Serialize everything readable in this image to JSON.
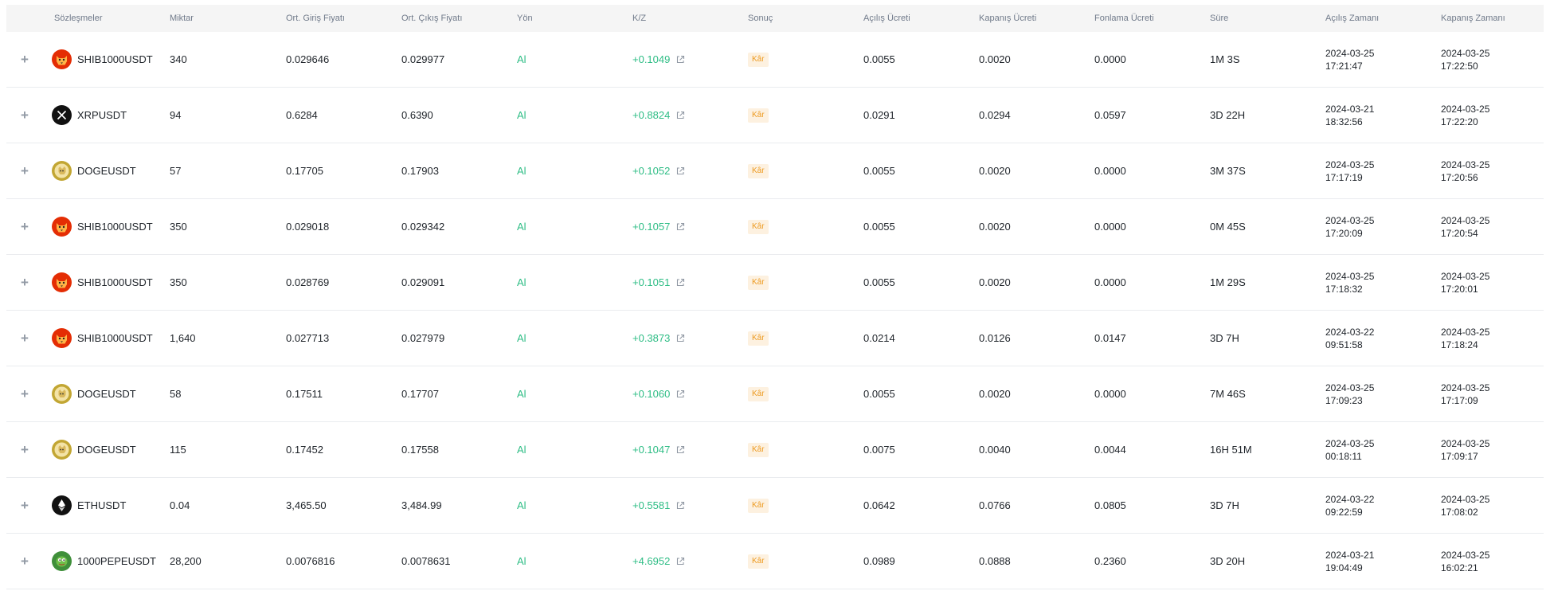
{
  "headers": {
    "contract": "Sözleşmeler",
    "qty": "Miktar",
    "entry": "Ort. Giriş Fiyatı",
    "exit": "Ort. Çıkış Fiyatı",
    "side": "Yön",
    "pnl": "K/Z",
    "result": "Sonuç",
    "open_fee": "Açılış Ücreti",
    "close_fee": "Kapanış Ücreti",
    "funding_fee": "Fonlama Ücreti",
    "duration": "Süre",
    "open_time": "Açılış Zamanı",
    "close_time": "Kapanış Zamanı"
  },
  "expand_label": "+",
  "icon_colors": {
    "shib": "#e42d04",
    "xrp": "#111111",
    "doge": "#c2a633",
    "eth": "#111111",
    "pepe": "#3f8f3a",
    "positive": "#2ebd85",
    "badge_text": "#ed9b22",
    "badge_bg": "#fdf1e0"
  },
  "rows": [
    {
      "icon": "shib-icon",
      "symbol": "SHIB1000USDT",
      "qty": "340",
      "entry": "0.029646",
      "exit": "0.029977",
      "side": "Al",
      "pnl": "+0.1049",
      "result": "Kâr",
      "open_fee": "0.0055",
      "close_fee": "0.0020",
      "funding_fee": "0.0000",
      "duration": "1M 3S",
      "open_date": "2024-03-25",
      "open_clock": "17:21:47",
      "close_date": "2024-03-25",
      "close_clock": "17:22:50"
    },
    {
      "icon": "xrp-icon",
      "symbol": "XRPUSDT",
      "qty": "94",
      "entry": "0.6284",
      "exit": "0.6390",
      "side": "Al",
      "pnl": "+0.8824",
      "result": "Kâr",
      "open_fee": "0.0291",
      "close_fee": "0.0294",
      "funding_fee": "0.0597",
      "duration": "3D 22H",
      "open_date": "2024-03-21",
      "open_clock": "18:32:56",
      "close_date": "2024-03-25",
      "close_clock": "17:22:20"
    },
    {
      "icon": "doge-icon",
      "symbol": "DOGEUSDT",
      "qty": "57",
      "entry": "0.17705",
      "exit": "0.17903",
      "side": "Al",
      "pnl": "+0.1052",
      "result": "Kâr",
      "open_fee": "0.0055",
      "close_fee": "0.0020",
      "funding_fee": "0.0000",
      "duration": "3M 37S",
      "open_date": "2024-03-25",
      "open_clock": "17:17:19",
      "close_date": "2024-03-25",
      "close_clock": "17:20:56"
    },
    {
      "icon": "shib-icon",
      "symbol": "SHIB1000USDT",
      "qty": "350",
      "entry": "0.029018",
      "exit": "0.029342",
      "side": "Al",
      "pnl": "+0.1057",
      "result": "Kâr",
      "open_fee": "0.0055",
      "close_fee": "0.0020",
      "funding_fee": "0.0000",
      "duration": "0M 45S",
      "open_date": "2024-03-25",
      "open_clock": "17:20:09",
      "close_date": "2024-03-25",
      "close_clock": "17:20:54"
    },
    {
      "icon": "shib-icon",
      "symbol": "SHIB1000USDT",
      "qty": "350",
      "entry": "0.028769",
      "exit": "0.029091",
      "side": "Al",
      "pnl": "+0.1051",
      "result": "Kâr",
      "open_fee": "0.0055",
      "close_fee": "0.0020",
      "funding_fee": "0.0000",
      "duration": "1M 29S",
      "open_date": "2024-03-25",
      "open_clock": "17:18:32",
      "close_date": "2024-03-25",
      "close_clock": "17:20:01"
    },
    {
      "icon": "shib-icon",
      "symbol": "SHIB1000USDT",
      "qty": "1,640",
      "entry": "0.027713",
      "exit": "0.027979",
      "side": "Al",
      "pnl": "+0.3873",
      "result": "Kâr",
      "open_fee": "0.0214",
      "close_fee": "0.0126",
      "funding_fee": "0.0147",
      "duration": "3D 7H",
      "open_date": "2024-03-22",
      "open_clock": "09:51:58",
      "close_date": "2024-03-25",
      "close_clock": "17:18:24"
    },
    {
      "icon": "doge-icon",
      "symbol": "DOGEUSDT",
      "qty": "58",
      "entry": "0.17511",
      "exit": "0.17707",
      "side": "Al",
      "pnl": "+0.1060",
      "result": "Kâr",
      "open_fee": "0.0055",
      "close_fee": "0.0020",
      "funding_fee": "0.0000",
      "duration": "7M 46S",
      "open_date": "2024-03-25",
      "open_clock": "17:09:23",
      "close_date": "2024-03-25",
      "close_clock": "17:17:09"
    },
    {
      "icon": "doge-icon",
      "symbol": "DOGEUSDT",
      "qty": "115",
      "entry": "0.17452",
      "exit": "0.17558",
      "side": "Al",
      "pnl": "+0.1047",
      "result": "Kâr",
      "open_fee": "0.0075",
      "close_fee": "0.0040",
      "funding_fee": "0.0044",
      "duration": "16H 51M",
      "open_date": "2024-03-25",
      "open_clock": "00:18:11",
      "close_date": "2024-03-25",
      "close_clock": "17:09:17"
    },
    {
      "icon": "eth-icon",
      "symbol": "ETHUSDT",
      "qty": "0.04",
      "entry": "3,465.50",
      "exit": "3,484.99",
      "side": "Al",
      "pnl": "+0.5581",
      "result": "Kâr",
      "open_fee": "0.0642",
      "close_fee": "0.0766",
      "funding_fee": "0.0805",
      "duration": "3D 7H",
      "open_date": "2024-03-22",
      "open_clock": "09:22:59",
      "close_date": "2024-03-25",
      "close_clock": "17:08:02"
    },
    {
      "icon": "pepe-icon",
      "symbol": "1000PEPEUSDT",
      "qty": "28,200",
      "entry": "0.0076816",
      "exit": "0.0078631",
      "side": "Al",
      "pnl": "+4.6952",
      "result": "Kâr",
      "open_fee": "0.0989",
      "close_fee": "0.0888",
      "funding_fee": "0.2360",
      "duration": "3D 20H",
      "open_date": "2024-03-21",
      "open_clock": "19:04:49",
      "close_date": "2024-03-25",
      "close_clock": "16:02:21"
    }
  ]
}
